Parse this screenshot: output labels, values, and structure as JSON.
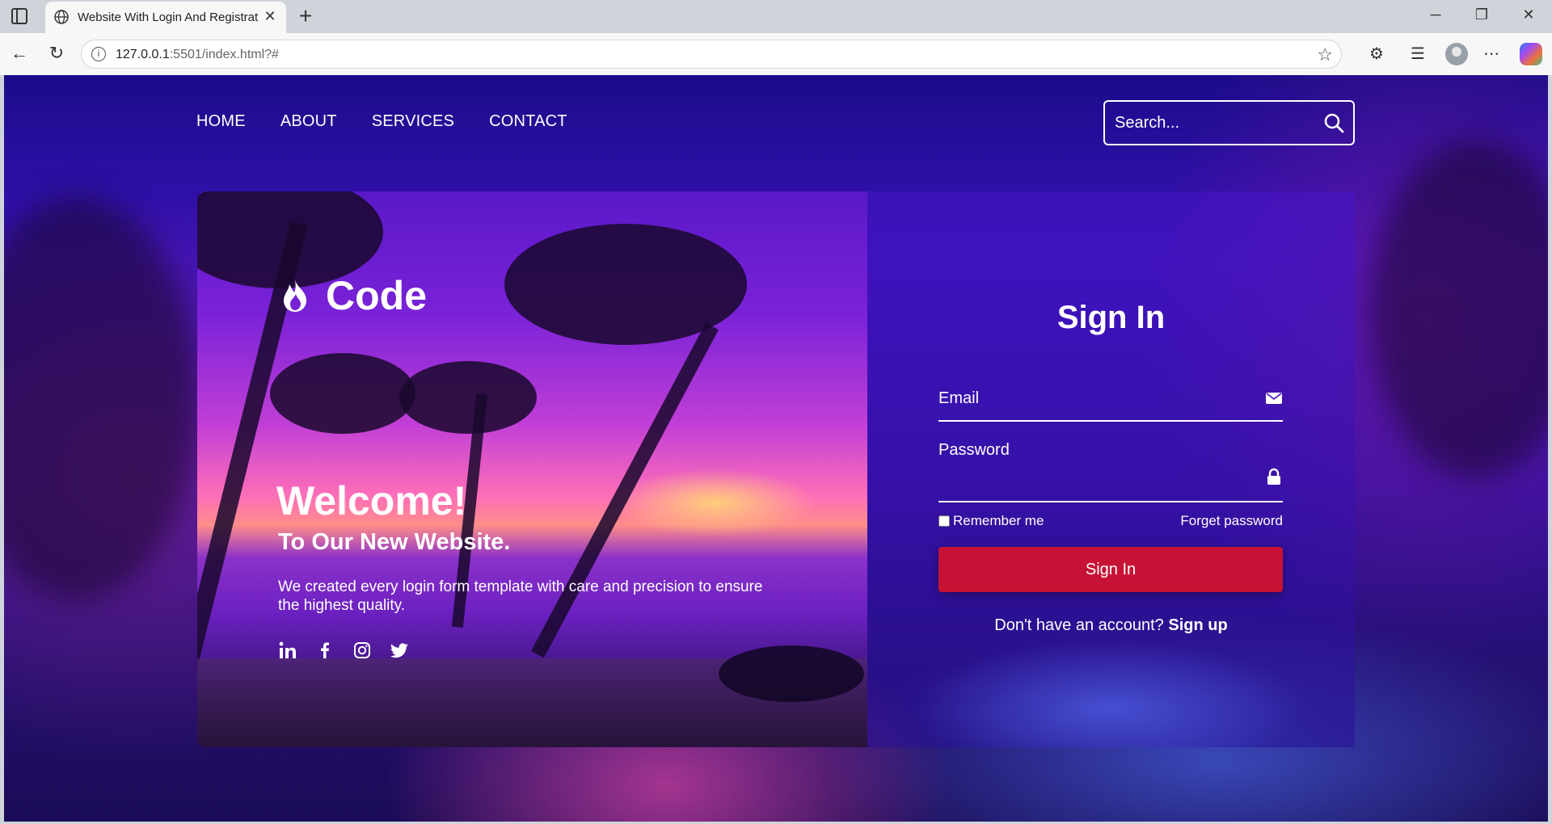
{
  "browser": {
    "tab_title": "Website With Login And Registrat",
    "url_host": "127.0.0.1",
    "url_rest": ":5501/index.html?#"
  },
  "nav": {
    "items": [
      "HOME",
      "ABOUT",
      "SERVICES",
      "CONTACT"
    ]
  },
  "search": {
    "placeholder": "Search..."
  },
  "hero": {
    "logo_text": "Code",
    "welcome": "Welcome!",
    "subtitle": "To Our New Website.",
    "description": "We created every login form template with care and precision to ensure the highest quality.",
    "socials": [
      "linkedin-icon",
      "facebook-icon",
      "instagram-icon",
      "twitter-icon"
    ]
  },
  "signin": {
    "title": "Sign In",
    "email_label": "Email",
    "password_label": "Password",
    "remember_label": "Remember me",
    "forget_label": "Forget password",
    "button_label": "Sign In",
    "no_account_text": "Don't have an account?",
    "signup_label": "Sign up"
  },
  "colors": {
    "button": "#c71235",
    "text": "#ffffff"
  }
}
